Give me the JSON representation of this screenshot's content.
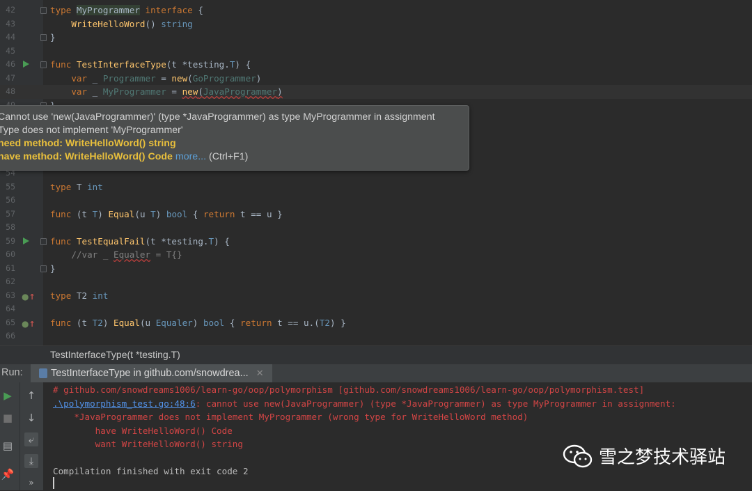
{
  "editor": {
    "lines": [
      {
        "n": "42",
        "tokens": [
          [
            "kw",
            "type "
          ],
          [
            "hl ty",
            "MyProgrammer"
          ],
          [
            "kw",
            " interface"
          ],
          [
            "ty",
            " {"
          ]
        ]
      },
      {
        "n": "43",
        "tokens": [
          [
            "ty",
            "    "
          ],
          [
            "fn",
            "WriteHelloWord"
          ],
          [
            "ty",
            "() "
          ],
          [
            "tyb",
            "string"
          ]
        ]
      },
      {
        "n": "44",
        "tokens": [
          [
            "ty",
            "}"
          ]
        ]
      },
      {
        "n": "45",
        "tokens": []
      },
      {
        "n": "46",
        "tokens": [
          [
            "kw",
            "func "
          ],
          [
            "fn",
            "TestInterfaceType"
          ],
          [
            "ty",
            "(t *testing."
          ],
          [
            "tyb",
            "T"
          ],
          [
            "ty",
            ") {"
          ]
        ]
      },
      {
        "n": "47",
        "tokens": [
          [
            "ty",
            "    "
          ],
          [
            "kw",
            "var"
          ],
          [
            "ty",
            " _ "
          ],
          [
            "tp",
            "Programmer"
          ],
          [
            "ty",
            " = "
          ],
          [
            "fn",
            "new"
          ],
          [
            "ty",
            "("
          ],
          [
            "tp",
            "GoProgrammer"
          ],
          [
            "ty",
            ")"
          ]
        ]
      },
      {
        "n": "48",
        "tokens": [
          [
            "ty",
            "    "
          ],
          [
            "kw",
            "var"
          ],
          [
            "ty",
            " _ "
          ],
          [
            "tp",
            "MyProgrammer"
          ],
          [
            "ty",
            " = "
          ],
          [
            "fn err",
            "new"
          ],
          [
            "ty err",
            "("
          ],
          [
            "tp err",
            "JavaProgrammer"
          ],
          [
            "ty err",
            ")"
          ]
        ]
      },
      {
        "n": "49",
        "tokens": [
          [
            "ty",
            "}"
          ]
        ]
      },
      {
        "n": "50",
        "tokens": []
      },
      {
        "n": "51",
        "tokens": []
      },
      {
        "n": "52",
        "tokens": []
      },
      {
        "n": "53",
        "tokens": []
      },
      {
        "n": "54",
        "tokens": []
      },
      {
        "n": "55",
        "tokens": [
          [
            "kw",
            "type "
          ],
          [
            "ty",
            "T "
          ],
          [
            "tyb",
            "int"
          ]
        ]
      },
      {
        "n": "56",
        "tokens": []
      },
      {
        "n": "57",
        "tokens": [
          [
            "kw",
            "func "
          ],
          [
            "ty",
            "(t "
          ],
          [
            "tyb",
            "T"
          ],
          [
            "ty",
            ") "
          ],
          [
            "fn",
            "Equal"
          ],
          [
            "ty",
            "(u "
          ],
          [
            "tyb",
            "T"
          ],
          [
            "ty",
            ") "
          ],
          [
            "tyb",
            "bool"
          ],
          [
            "ty",
            " { "
          ],
          [
            "kw",
            "return"
          ],
          [
            "ty",
            " t == u }"
          ]
        ]
      },
      {
        "n": "58",
        "tokens": []
      },
      {
        "n": "59",
        "tokens": [
          [
            "kw",
            "func "
          ],
          [
            "fn",
            "TestEqualFail"
          ],
          [
            "ty",
            "(t *testing."
          ],
          [
            "tyb",
            "T"
          ],
          [
            "ty",
            ") {"
          ]
        ]
      },
      {
        "n": "60",
        "tokens": [
          [
            "cm",
            "    //var _ "
          ],
          [
            "cm err",
            "Equaler"
          ],
          [
            "cm",
            " = T{}"
          ]
        ]
      },
      {
        "n": "61",
        "tokens": [
          [
            "ty",
            "}"
          ]
        ]
      },
      {
        "n": "62",
        "tokens": []
      },
      {
        "n": "63",
        "tokens": [
          [
            "kw",
            "type "
          ],
          [
            "ty",
            "T2 "
          ],
          [
            "tyb",
            "int"
          ]
        ]
      },
      {
        "n": "64",
        "tokens": []
      },
      {
        "n": "65",
        "tokens": [
          [
            "kw",
            "func "
          ],
          [
            "ty",
            "(t "
          ],
          [
            "tyb",
            "T2"
          ],
          [
            "ty",
            ") "
          ],
          [
            "fn",
            "Equal"
          ],
          [
            "ty",
            "(u "
          ],
          [
            "tyb",
            "Equaler"
          ],
          [
            "ty",
            ") "
          ],
          [
            "tyb",
            "bool"
          ],
          [
            "ty",
            " { "
          ],
          [
            "kw",
            "return"
          ],
          [
            "ty",
            " t == u.("
          ],
          [
            "tyb",
            "T2"
          ],
          [
            "ty",
            ") }"
          ]
        ]
      },
      {
        "n": "66",
        "tokens": []
      }
    ]
  },
  "tooltip": {
    "line1": "Cannot use 'new(JavaProgrammer)' (type *JavaProgrammer) as type MyProgrammer in assignment",
    "line2": "Type does not implement 'MyProgrammer'",
    "line3": "need method: WriteHelloWord() string",
    "line4_bold": "have method: WriteHelloWord() Code",
    "line4_link": "more...",
    "line4_shortcut": " (Ctrl+F1)"
  },
  "breadcrumb": "TestInterfaceType(t *testing.T)",
  "run": {
    "label": "Run:",
    "tab": "TestInterfaceType in github.com/snowdrea...",
    "console": {
      "l1": "# github.com/snowdreams1006/learn-go/oop/polymorphism [github.com/snowdreams1006/learn-go/oop/polymorphism.test]",
      "l2_link": ".\\polymorphism_test.go:48:6",
      "l2_rest": ": cannot use new(JavaProgrammer) (type *JavaProgrammer) as type MyProgrammer in assignment:",
      "l3": "    *JavaProgrammer does not implement MyProgrammer (wrong type for WriteHelloWord method)",
      "l4": "        have WriteHelloWord() Code",
      "l5": "        want WriteHelloWord() string",
      "l6": "Compilation finished with exit code 2"
    }
  },
  "watermark": "雪之梦技术驿站",
  "colors": {
    "accent": "#499c54",
    "error": "#d24545",
    "link": "#5394ec"
  }
}
